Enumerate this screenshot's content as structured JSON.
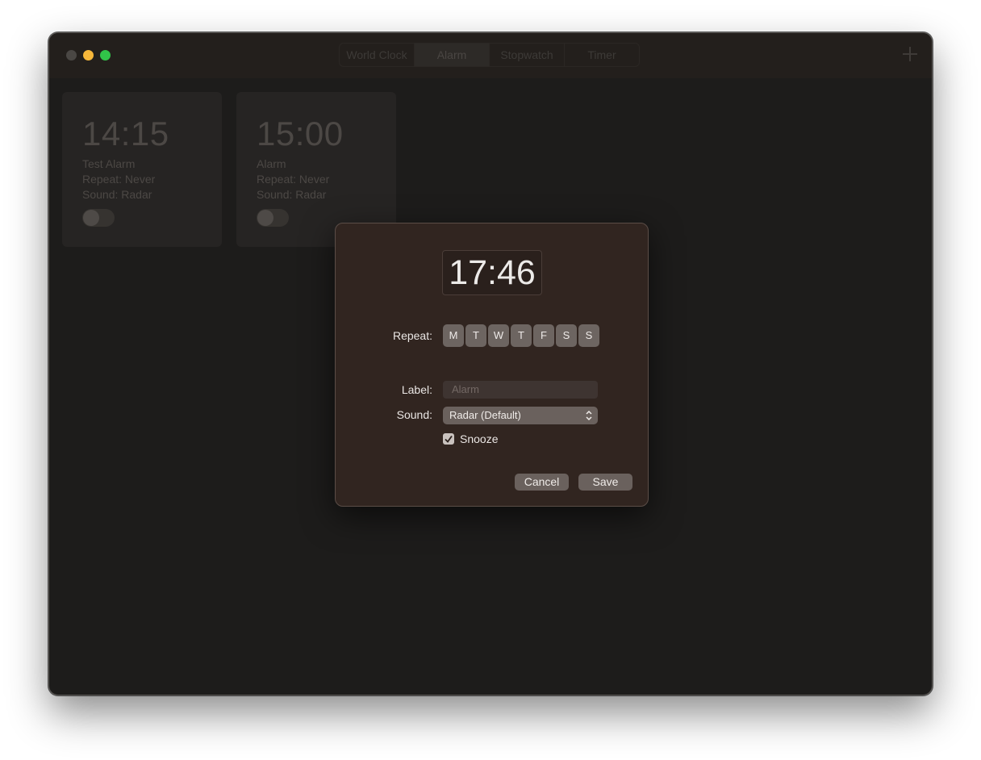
{
  "window": {
    "tabs": [
      {
        "label": "World Clock",
        "active": false
      },
      {
        "label": "Alarm",
        "active": true
      },
      {
        "label": "Stopwatch",
        "active": false
      },
      {
        "label": "Timer",
        "active": false
      }
    ],
    "add_icon": "plus-icon"
  },
  "alarms": [
    {
      "time": "14:15",
      "name": "Test Alarm",
      "repeat": "Repeat: Never",
      "sound": "Sound: Radar",
      "enabled": false
    },
    {
      "time": "15:00",
      "name": "Alarm",
      "repeat": "Repeat: Never",
      "sound": "Sound: Radar",
      "enabled": false
    }
  ],
  "dialog": {
    "time": "17:46",
    "repeat_label": "Repeat:",
    "days": [
      "M",
      "T",
      "W",
      "T",
      "F",
      "S",
      "S"
    ],
    "label_label": "Label:",
    "label_placeholder": "Alarm",
    "sound_label": "Sound:",
    "sound_value": "Radar (Default)",
    "snooze_label": "Snooze",
    "snooze_checked": true,
    "cancel_label": "Cancel",
    "save_label": "Save"
  },
  "colors": {
    "traffic_min": "#f6b73a",
    "traffic_max": "#31c449",
    "dialog_bg": "#312520",
    "button_bg": "#6a615d"
  }
}
